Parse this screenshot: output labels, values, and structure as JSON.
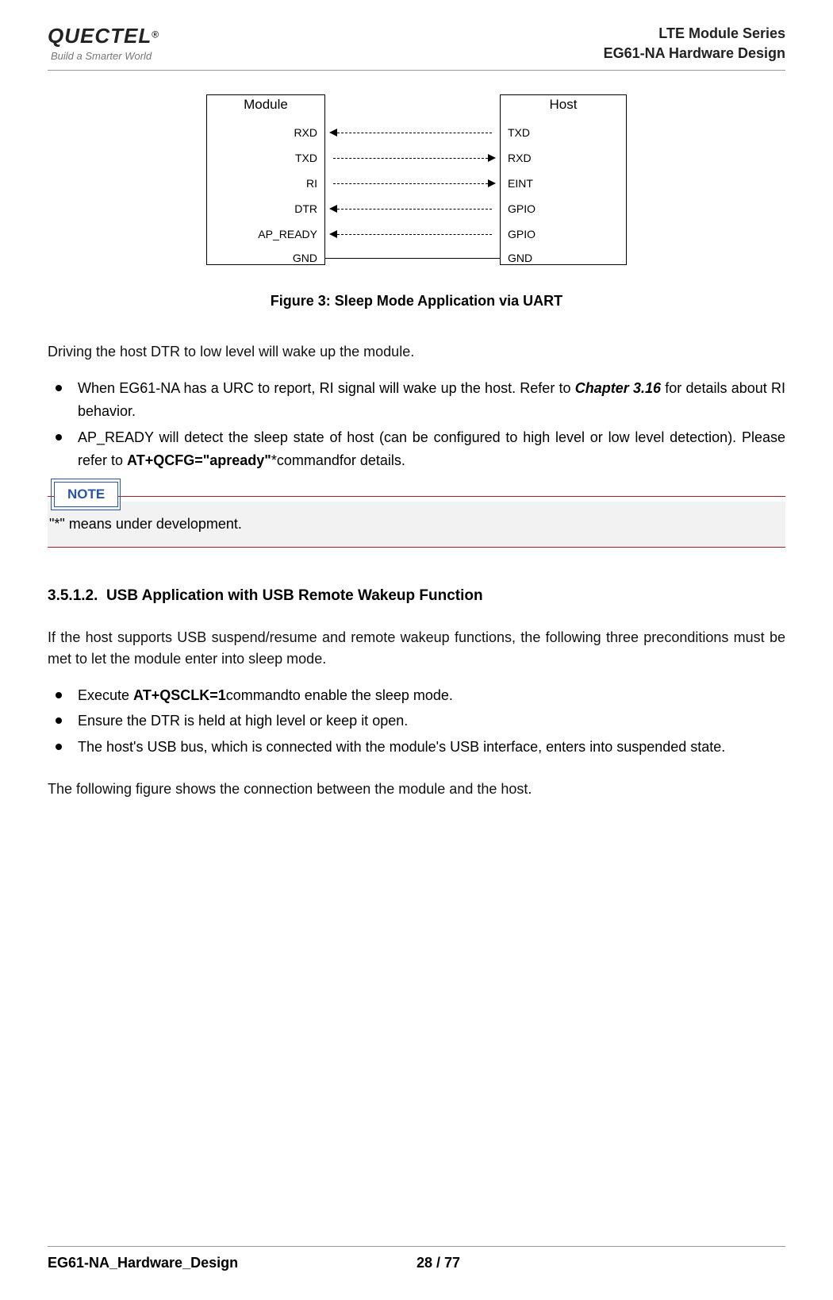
{
  "header": {
    "logo_main": "QUECTEL",
    "logo_reg": "®",
    "logo_sub": "Build a Smarter World",
    "right_line1": "LTE Module Series",
    "right_line2": "EG61-NA Hardware Design"
  },
  "diagram": {
    "module_title": "Module",
    "host_title": "Host",
    "module_signals": [
      "RXD",
      "TXD",
      "RI",
      "DTR",
      "AP_READY",
      "GND"
    ],
    "host_signals": [
      "TXD",
      "RXD",
      "EINT",
      "GPIO",
      "GPIO",
      "GND"
    ]
  },
  "figure_caption": "Figure 3: Sleep Mode Application via UART",
  "para1": "Driving the host DTR to low level will wake up the module.",
  "bullets1": {
    "b1_pre": "When EG61-NA has a URC to report, RI signal will wake up the host. Refer to ",
    "b1_chapter": "Chapter 3.16",
    "b1_post": " for details about RI behavior.",
    "b2_pre": "AP_READY will detect the sleep state of host (can be configured to high level or low level detection). Please refer to ",
    "b2_cmd": "AT+QCFG=\"apready\"",
    "b2_post": "*commandfor details."
  },
  "note": {
    "label": "NOTE",
    "text": "\"*\" means under development."
  },
  "section_number": "3.5.1.2.",
  "section_title": "USB Application with USB Remote Wakeup Function",
  "para2": "If the host supports USB suspend/resume and remote wakeup functions, the following three preconditions must be met to let the module enter into sleep mode.",
  "bullets2": {
    "b1_pre": "Execute ",
    "b1_cmd": "AT+QSCLK=1",
    "b1_post": "commandto enable the sleep mode.",
    "b2": "Ensure the DTR is held at high level or keep it open.",
    "b3": "The host's USB bus, which is connected with the module's USB interface, enters into suspended state."
  },
  "para3": "The following figure shows the connection between the module and the host.",
  "footer": {
    "left": "EG61-NA_Hardware_Design",
    "page": "28 / 77"
  }
}
